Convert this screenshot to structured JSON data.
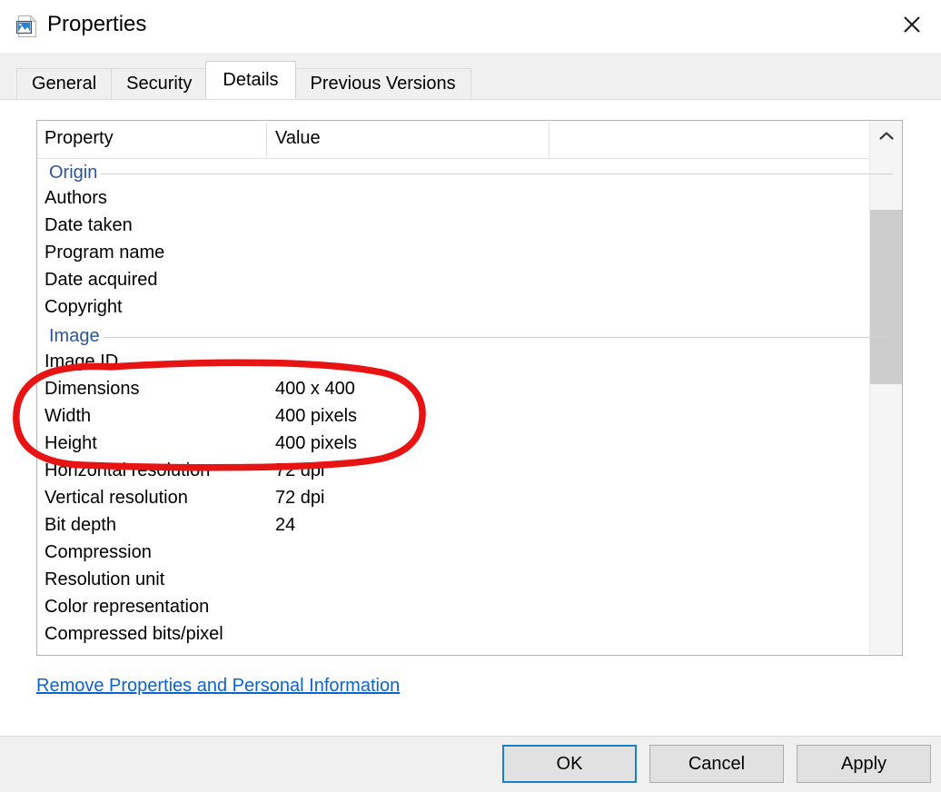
{
  "window": {
    "title": "Properties",
    "icon": "image-file-icon",
    "close_label": "✕"
  },
  "tabs": [
    {
      "label": "General",
      "active": false
    },
    {
      "label": "Security",
      "active": false
    },
    {
      "label": "Details",
      "active": true
    },
    {
      "label": "Previous Versions",
      "active": false
    }
  ],
  "list": {
    "columns": [
      "Property",
      "Value"
    ],
    "rows": [
      {
        "type": "group",
        "name": "Origin",
        "value": ""
      },
      {
        "type": "item",
        "name": "Authors",
        "value": ""
      },
      {
        "type": "item",
        "name": "Date taken",
        "value": ""
      },
      {
        "type": "item",
        "name": "Program name",
        "value": ""
      },
      {
        "type": "item",
        "name": "Date acquired",
        "value": ""
      },
      {
        "type": "item",
        "name": "Copyright",
        "value": ""
      },
      {
        "type": "group",
        "name": "Image",
        "value": ""
      },
      {
        "type": "item",
        "name": "Image ID",
        "value": ""
      },
      {
        "type": "item",
        "name": "Dimensions",
        "value": "400 x 400"
      },
      {
        "type": "item",
        "name": "Width",
        "value": "400 pixels"
      },
      {
        "type": "item",
        "name": "Height",
        "value": "400 pixels"
      },
      {
        "type": "item",
        "name": "Horizontal resolution",
        "value": "72 dpi"
      },
      {
        "type": "item",
        "name": "Vertical resolution",
        "value": "72 dpi"
      },
      {
        "type": "item",
        "name": "Bit depth",
        "value": "24"
      },
      {
        "type": "item",
        "name": "Compression",
        "value": ""
      },
      {
        "type": "item",
        "name": "Resolution unit",
        "value": ""
      },
      {
        "type": "item",
        "name": "Color representation",
        "value": ""
      },
      {
        "type": "item",
        "name": "Compressed bits/pixel",
        "value": ""
      }
    ]
  },
  "scrollbar": {
    "up_arrow": "chevron-up-icon"
  },
  "link": {
    "remove_label": "Remove Properties and Personal Information"
  },
  "footer": {
    "ok_label": "OK",
    "cancel_label": "Cancel",
    "apply_label": "Apply"
  },
  "annotation": {
    "shape": "hand-drawn-ellipse",
    "color": "#e81313",
    "encircles": [
      "Dimensions",
      "Width",
      "Height"
    ]
  },
  "colors": {
    "group_header": "#2a5699",
    "link": "#0b63ce",
    "focus_border": "#1b7fc4",
    "dialog_chrome": "#f0f0f0",
    "annotation_red": "#e81313"
  }
}
